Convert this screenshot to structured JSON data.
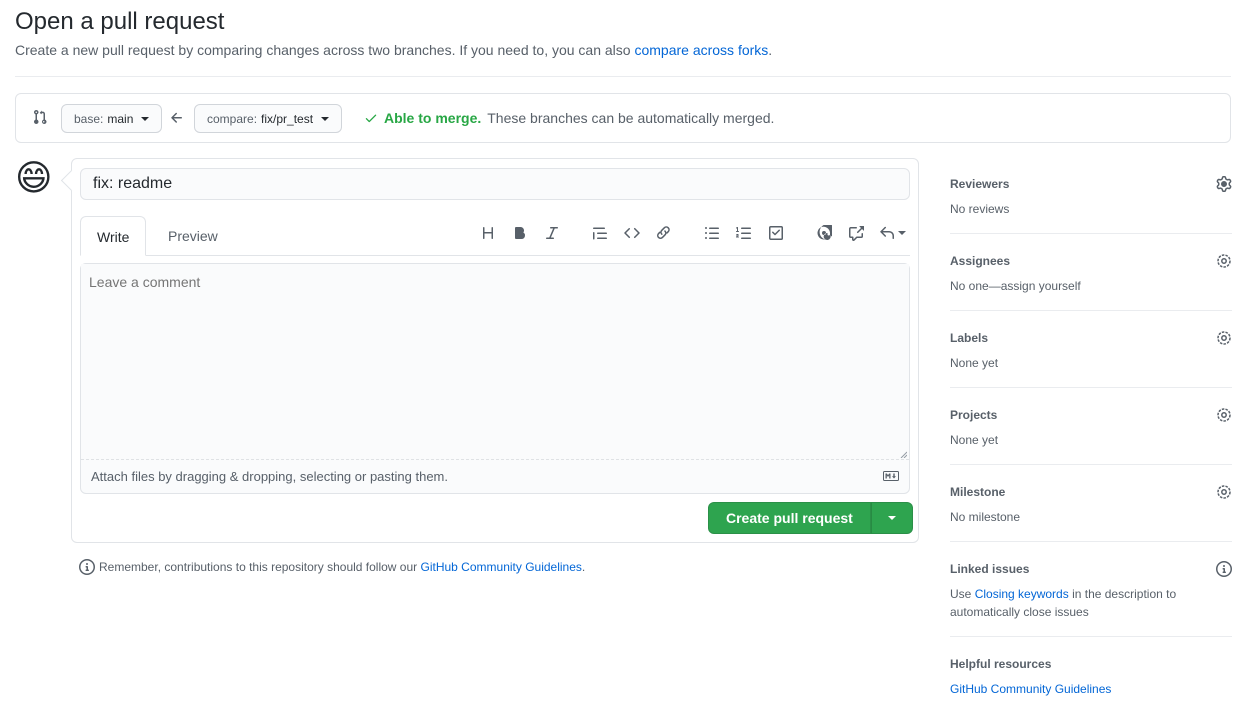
{
  "header": {
    "title": "Open a pull request",
    "description": "Create a new pull request by comparing changes across two branches. If you need to, you can also ",
    "description_link": "compare across forks",
    "description_end": "."
  },
  "range": {
    "base_prefix": "base:",
    "base_branch": "main",
    "compare_prefix": "compare:",
    "compare_branch": "fix/pr_test",
    "merge_ok": "Able to merge.",
    "merge_text": "These branches can be automatically merged."
  },
  "composer": {
    "title_value": "fix: readme",
    "tabs": [
      "Write",
      "Preview"
    ],
    "comment_placeholder": "Leave a comment",
    "attach_text": "Attach files by dragging & dropping, selecting or pasting them.",
    "submit_label": "Create pull request",
    "toolbar_icons": [
      "heading-icon",
      "bold-icon",
      "italic-icon",
      "quote-icon",
      "code-icon",
      "link-icon",
      "unordered-list-icon",
      "ordered-list-icon",
      "task-list-icon",
      "mention-icon",
      "cross-reference-icon",
      "reply-icon"
    ]
  },
  "reminder": {
    "text": "Remember, contributions to this repository should follow our ",
    "link": "GitHub Community Guidelines",
    "end": "."
  },
  "sidebar": {
    "reviewers": {
      "title": "Reviewers",
      "value": "No reviews"
    },
    "assignees": {
      "title": "Assignees",
      "value": "No one—assign yourself"
    },
    "labels": {
      "title": "Labels",
      "value": "None yet"
    },
    "projects": {
      "title": "Projects",
      "value": "None yet"
    },
    "milestone": {
      "title": "Milestone",
      "value": "No milestone"
    },
    "linked": {
      "title": "Linked issues",
      "pre": "Use ",
      "link": "Closing keywords",
      "post": " in the description to automatically close issues"
    },
    "helpful": {
      "title": "Helpful resources",
      "link": "GitHub Community Guidelines"
    }
  },
  "colors": {
    "accent": "#0366d6",
    "success": "#28a745",
    "button": "#2ea44f",
    "muted": "#586069"
  }
}
